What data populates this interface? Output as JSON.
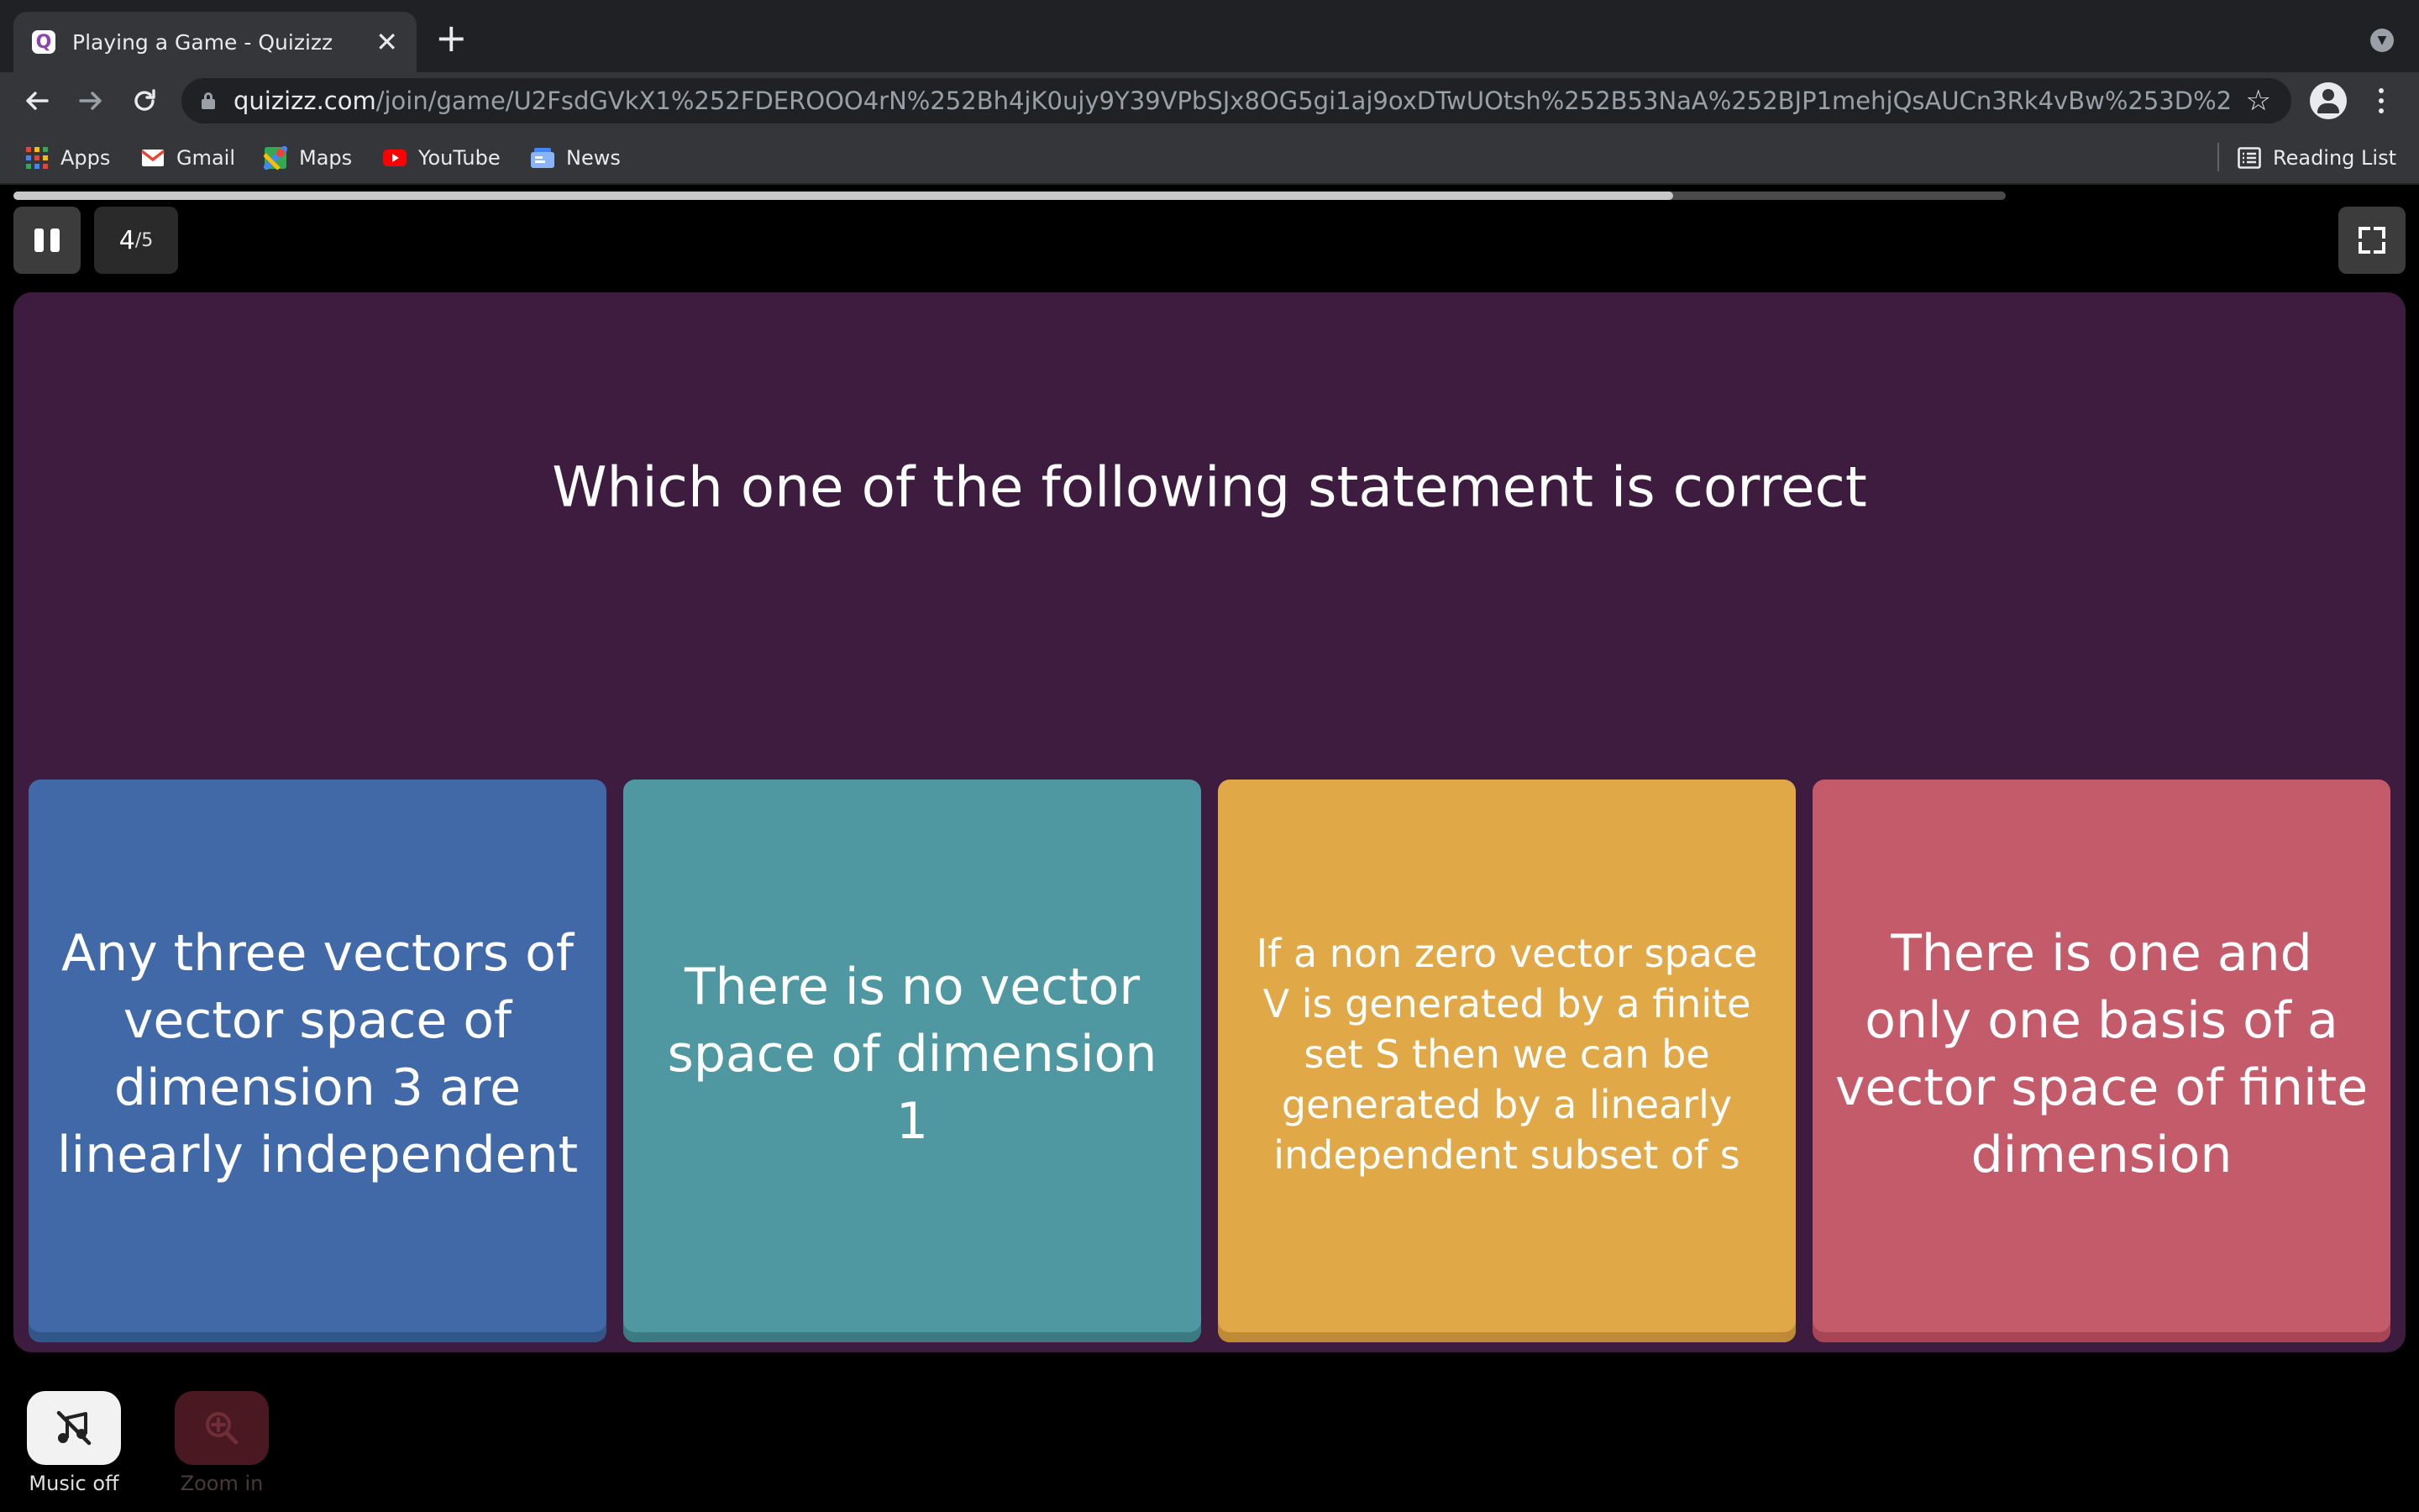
{
  "browser": {
    "tab_title": "Playing a Game - Quizizz",
    "tab_favicon": "Q",
    "url_host": "quizizz.com",
    "url_path": "/join/game/U2FsdGVkX1%252FDEROOO4rN%252Bh4jK0ujy9Y39VPbSJx8OG5gi1aj9oxDTwUOtsh%252B53NaA%252BJP1mehjQsAUCn3Rk4vBw%253D%253D?gam...",
    "bookmarks": [
      {
        "label": "Apps",
        "icon": "apps-grid-icon"
      },
      {
        "label": "Gmail",
        "icon": "gmail-icon"
      },
      {
        "label": "Maps",
        "icon": "maps-icon"
      },
      {
        "label": "YouTube",
        "icon": "youtube-icon"
      },
      {
        "label": "News",
        "icon": "news-icon"
      }
    ],
    "reading_list": "Reading List"
  },
  "quiz": {
    "progress_fraction": 0.833,
    "current": "4",
    "total": "/5",
    "question": "Which one of the following statement is correct",
    "options": [
      {
        "text": "Any three vectors of vector space of dimension 3 are linearly independent",
        "color": "#4169a8",
        "shadow": "#335689"
      },
      {
        "text": "There is no vector space of dimension 1",
        "color": "#4f98a1",
        "shadow": "#3c7a82"
      },
      {
        "text": "If a non zero vector space V is generated by a finite set S then we can be generated by a linearly independent subset of s",
        "color": "#e1a847",
        "shadow": "#bf8a36"
      },
      {
        "text": "There is one and only one basis of a vector space of finite dimension",
        "color": "#c45b6a",
        "shadow": "#a64553"
      }
    ]
  },
  "controls": {
    "music_label": "Music off",
    "zoom_label": "Zoom in"
  },
  "colors": {
    "panel": "#3d1c3f",
    "page_background": "#000000"
  }
}
